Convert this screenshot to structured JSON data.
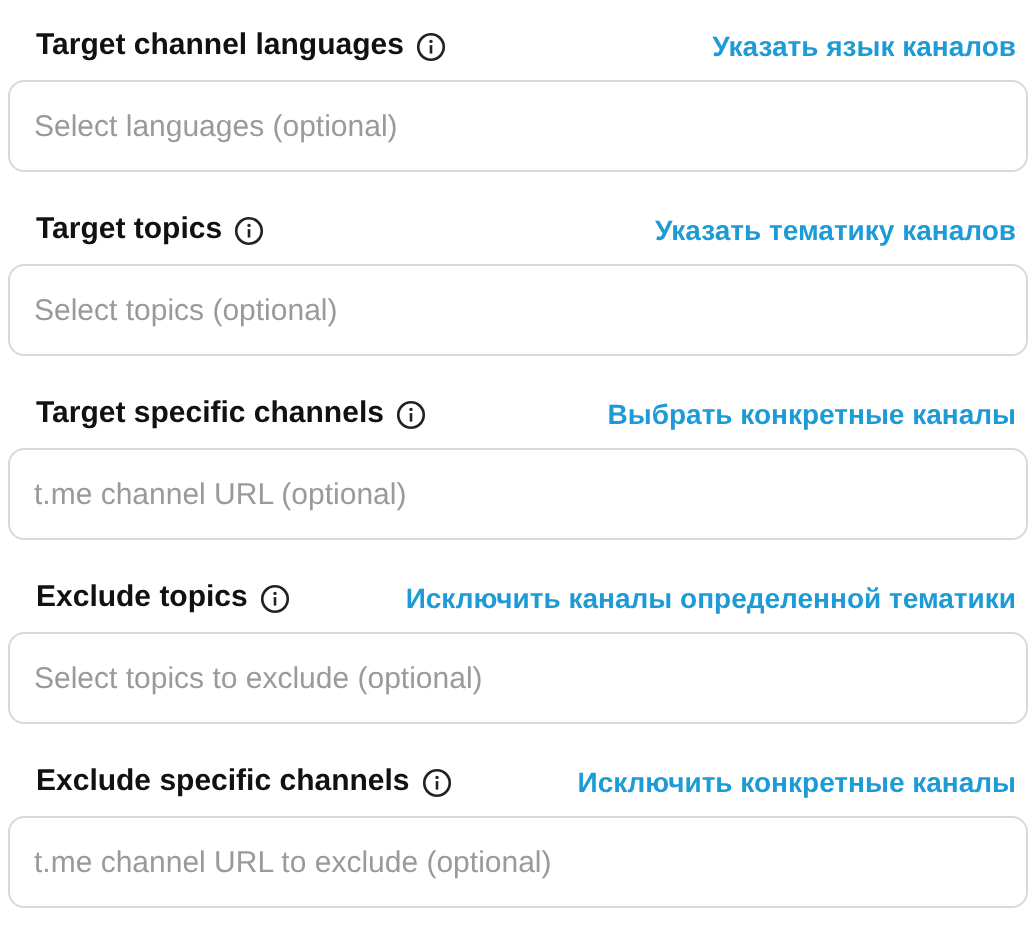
{
  "fields": [
    {
      "label": "Target channel languages",
      "annotation": "Указать язык каналов",
      "placeholder": "Select languages (optional)"
    },
    {
      "label": "Target topics",
      "annotation": "Указать тематику каналов",
      "placeholder": "Select topics (optional)"
    },
    {
      "label": "Target specific channels",
      "annotation": "Выбрать конкретные каналы",
      "placeholder": "t.me channel URL (optional)"
    },
    {
      "label": "Exclude topics",
      "annotation": "Исключить каналы определенной тематики",
      "placeholder": "Select topics to exclude (optional)"
    },
    {
      "label": "Exclude specific channels",
      "annotation": "Исключить конкретные каналы",
      "placeholder": "t.me channel URL to exclude (optional)"
    }
  ]
}
